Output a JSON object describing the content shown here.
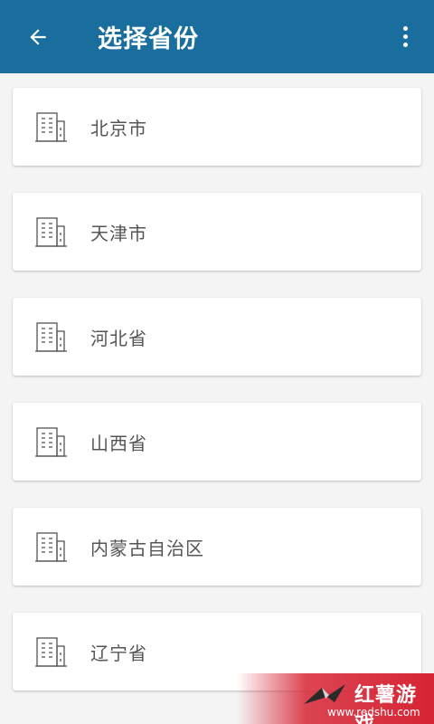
{
  "appbar": {
    "back_icon": "arrow-left-icon",
    "title": "选择省份",
    "menu_icon": "more-vert-icon",
    "background": "#1a6e9e"
  },
  "provinces": [
    {
      "label": "北京市",
      "icon": "building-icon"
    },
    {
      "label": "天津市",
      "icon": "building-icon"
    },
    {
      "label": "河北省",
      "icon": "building-icon"
    },
    {
      "label": "山西省",
      "icon": "building-icon"
    },
    {
      "label": "内蒙古自治区",
      "icon": "building-icon"
    },
    {
      "label": "辽宁省",
      "icon": "building-icon"
    }
  ],
  "watermark": {
    "text": "红薯游戏",
    "url": "www.redshu.com",
    "color": "#d62434"
  }
}
